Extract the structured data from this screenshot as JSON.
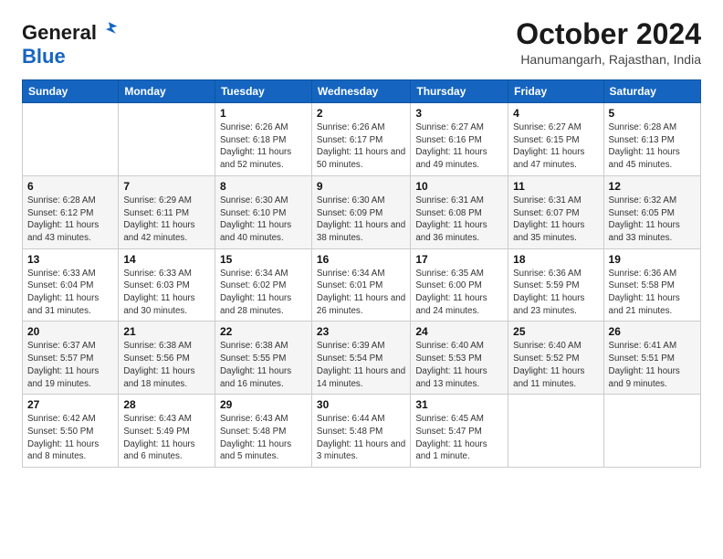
{
  "logo": {
    "general": "General",
    "blue": "Blue"
  },
  "header": {
    "month": "October 2024",
    "location": "Hanumangarh, Rajasthan, India"
  },
  "days_of_week": [
    "Sunday",
    "Monday",
    "Tuesday",
    "Wednesday",
    "Thursday",
    "Friday",
    "Saturday"
  ],
  "weeks": [
    [
      {
        "day": "",
        "info": ""
      },
      {
        "day": "",
        "info": ""
      },
      {
        "day": "1",
        "info": "Sunrise: 6:26 AM\nSunset: 6:18 PM\nDaylight: 11 hours and 52 minutes."
      },
      {
        "day": "2",
        "info": "Sunrise: 6:26 AM\nSunset: 6:17 PM\nDaylight: 11 hours and 50 minutes."
      },
      {
        "day": "3",
        "info": "Sunrise: 6:27 AM\nSunset: 6:16 PM\nDaylight: 11 hours and 49 minutes."
      },
      {
        "day": "4",
        "info": "Sunrise: 6:27 AM\nSunset: 6:15 PM\nDaylight: 11 hours and 47 minutes."
      },
      {
        "day": "5",
        "info": "Sunrise: 6:28 AM\nSunset: 6:13 PM\nDaylight: 11 hours and 45 minutes."
      }
    ],
    [
      {
        "day": "6",
        "info": "Sunrise: 6:28 AM\nSunset: 6:12 PM\nDaylight: 11 hours and 43 minutes."
      },
      {
        "day": "7",
        "info": "Sunrise: 6:29 AM\nSunset: 6:11 PM\nDaylight: 11 hours and 42 minutes."
      },
      {
        "day": "8",
        "info": "Sunrise: 6:30 AM\nSunset: 6:10 PM\nDaylight: 11 hours and 40 minutes."
      },
      {
        "day": "9",
        "info": "Sunrise: 6:30 AM\nSunset: 6:09 PM\nDaylight: 11 hours and 38 minutes."
      },
      {
        "day": "10",
        "info": "Sunrise: 6:31 AM\nSunset: 6:08 PM\nDaylight: 11 hours and 36 minutes."
      },
      {
        "day": "11",
        "info": "Sunrise: 6:31 AM\nSunset: 6:07 PM\nDaylight: 11 hours and 35 minutes."
      },
      {
        "day": "12",
        "info": "Sunrise: 6:32 AM\nSunset: 6:05 PM\nDaylight: 11 hours and 33 minutes."
      }
    ],
    [
      {
        "day": "13",
        "info": "Sunrise: 6:33 AM\nSunset: 6:04 PM\nDaylight: 11 hours and 31 minutes."
      },
      {
        "day": "14",
        "info": "Sunrise: 6:33 AM\nSunset: 6:03 PM\nDaylight: 11 hours and 30 minutes."
      },
      {
        "day": "15",
        "info": "Sunrise: 6:34 AM\nSunset: 6:02 PM\nDaylight: 11 hours and 28 minutes."
      },
      {
        "day": "16",
        "info": "Sunrise: 6:34 AM\nSunset: 6:01 PM\nDaylight: 11 hours and 26 minutes."
      },
      {
        "day": "17",
        "info": "Sunrise: 6:35 AM\nSunset: 6:00 PM\nDaylight: 11 hours and 24 minutes."
      },
      {
        "day": "18",
        "info": "Sunrise: 6:36 AM\nSunset: 5:59 PM\nDaylight: 11 hours and 23 minutes."
      },
      {
        "day": "19",
        "info": "Sunrise: 6:36 AM\nSunset: 5:58 PM\nDaylight: 11 hours and 21 minutes."
      }
    ],
    [
      {
        "day": "20",
        "info": "Sunrise: 6:37 AM\nSunset: 5:57 PM\nDaylight: 11 hours and 19 minutes."
      },
      {
        "day": "21",
        "info": "Sunrise: 6:38 AM\nSunset: 5:56 PM\nDaylight: 11 hours and 18 minutes."
      },
      {
        "day": "22",
        "info": "Sunrise: 6:38 AM\nSunset: 5:55 PM\nDaylight: 11 hours and 16 minutes."
      },
      {
        "day": "23",
        "info": "Sunrise: 6:39 AM\nSunset: 5:54 PM\nDaylight: 11 hours and 14 minutes."
      },
      {
        "day": "24",
        "info": "Sunrise: 6:40 AM\nSunset: 5:53 PM\nDaylight: 11 hours and 13 minutes."
      },
      {
        "day": "25",
        "info": "Sunrise: 6:40 AM\nSunset: 5:52 PM\nDaylight: 11 hours and 11 minutes."
      },
      {
        "day": "26",
        "info": "Sunrise: 6:41 AM\nSunset: 5:51 PM\nDaylight: 11 hours and 9 minutes."
      }
    ],
    [
      {
        "day": "27",
        "info": "Sunrise: 6:42 AM\nSunset: 5:50 PM\nDaylight: 11 hours and 8 minutes."
      },
      {
        "day": "28",
        "info": "Sunrise: 6:43 AM\nSunset: 5:49 PM\nDaylight: 11 hours and 6 minutes."
      },
      {
        "day": "29",
        "info": "Sunrise: 6:43 AM\nSunset: 5:48 PM\nDaylight: 11 hours and 5 minutes."
      },
      {
        "day": "30",
        "info": "Sunrise: 6:44 AM\nSunset: 5:48 PM\nDaylight: 11 hours and 3 minutes."
      },
      {
        "day": "31",
        "info": "Sunrise: 6:45 AM\nSunset: 5:47 PM\nDaylight: 11 hours and 1 minute."
      },
      {
        "day": "",
        "info": ""
      },
      {
        "day": "",
        "info": ""
      }
    ]
  ]
}
